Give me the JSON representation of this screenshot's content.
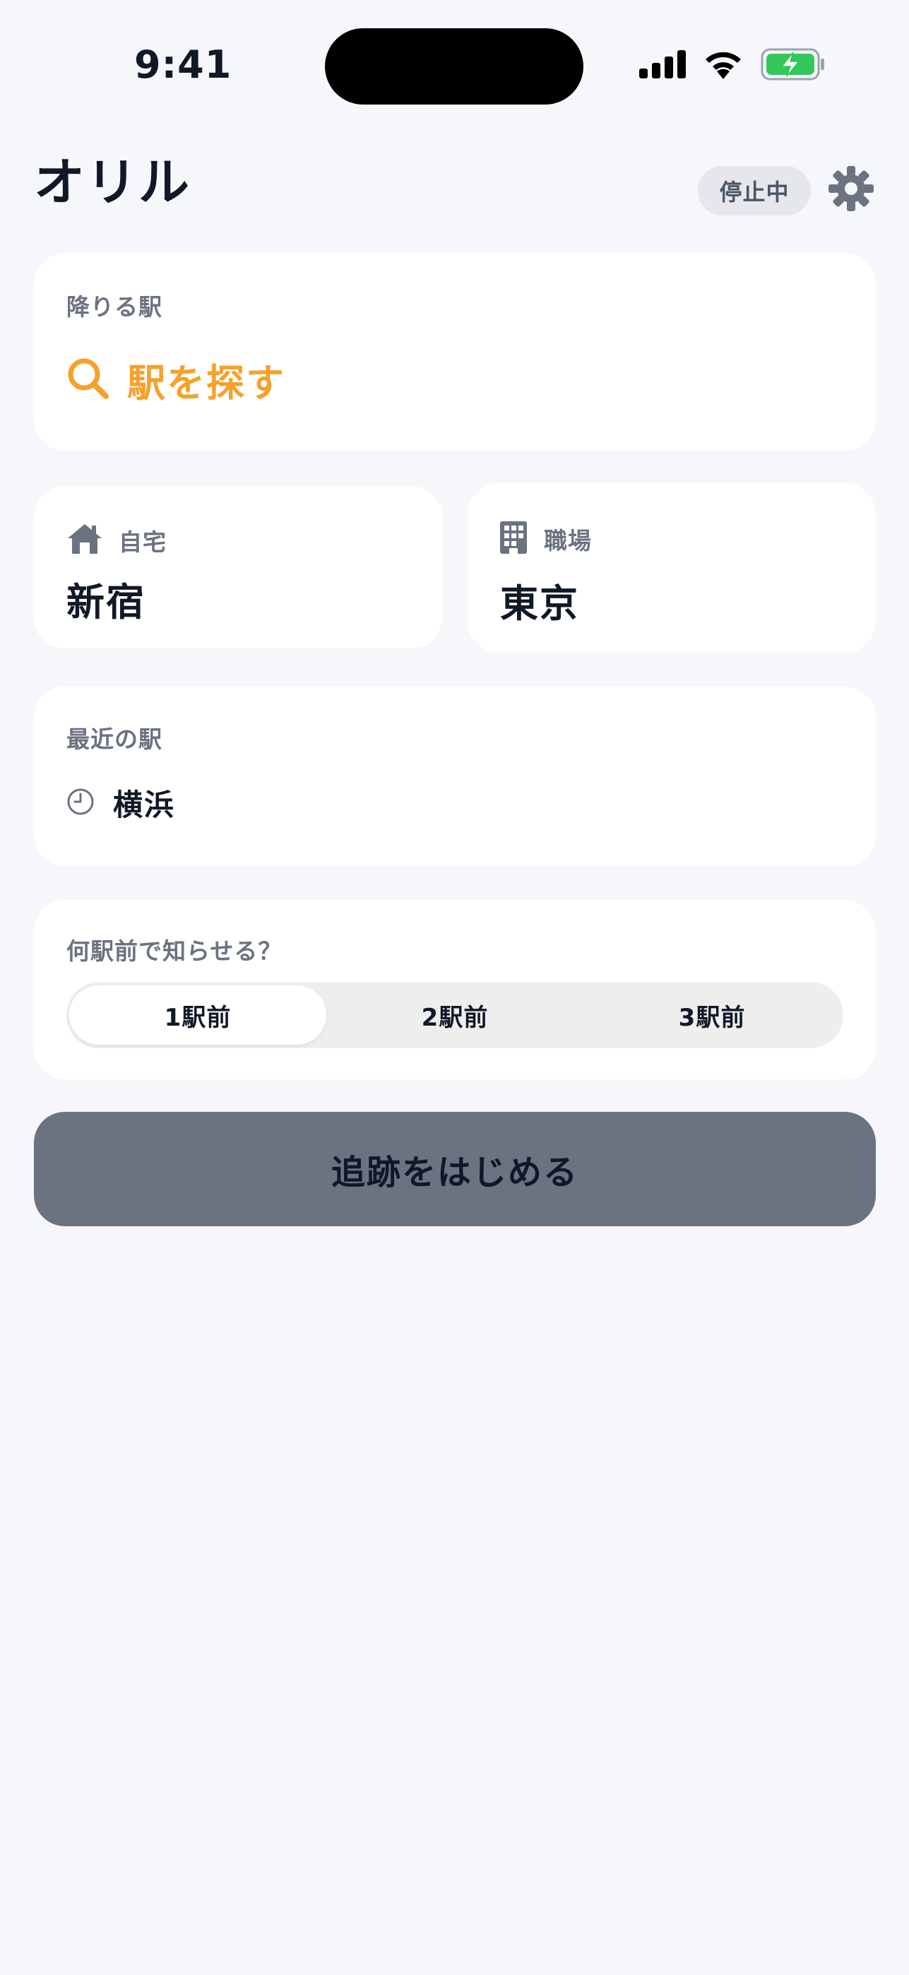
{
  "status_bar": {
    "time": "9:41",
    "icons": [
      "cellular-signal-icon",
      "wifi-icon",
      "battery-charging-icon"
    ]
  },
  "header": {
    "title": "オリル",
    "status_badge": "停止中",
    "settings_icon": "gear-icon"
  },
  "destination": {
    "label": "降りる駅",
    "search_label": "駅を探す",
    "search_icon": "search-icon"
  },
  "favorites": {
    "home": {
      "label": "自宅",
      "station": "新宿",
      "icon": "house-icon"
    },
    "work": {
      "label": "職場",
      "station": "東京",
      "icon": "building-icon"
    }
  },
  "recent": {
    "label": "最近の駅",
    "items": [
      {
        "name": "横浜",
        "icon": "clock-icon"
      }
    ]
  },
  "notify": {
    "label": "何駅前で知らせる？",
    "options": [
      "1駅前",
      "2駅前",
      "3駅前"
    ],
    "selected_index": 0
  },
  "start_button": {
    "label": "追跡をはじめる"
  },
  "colors": {
    "background": "#F5F7FB",
    "card": "#FFFFFF",
    "accent": "#F5A12B",
    "muted_text": "#6B7280",
    "primary_text": "#111827",
    "button_disabled": "#6B7280",
    "battery_green": "#34C759"
  }
}
